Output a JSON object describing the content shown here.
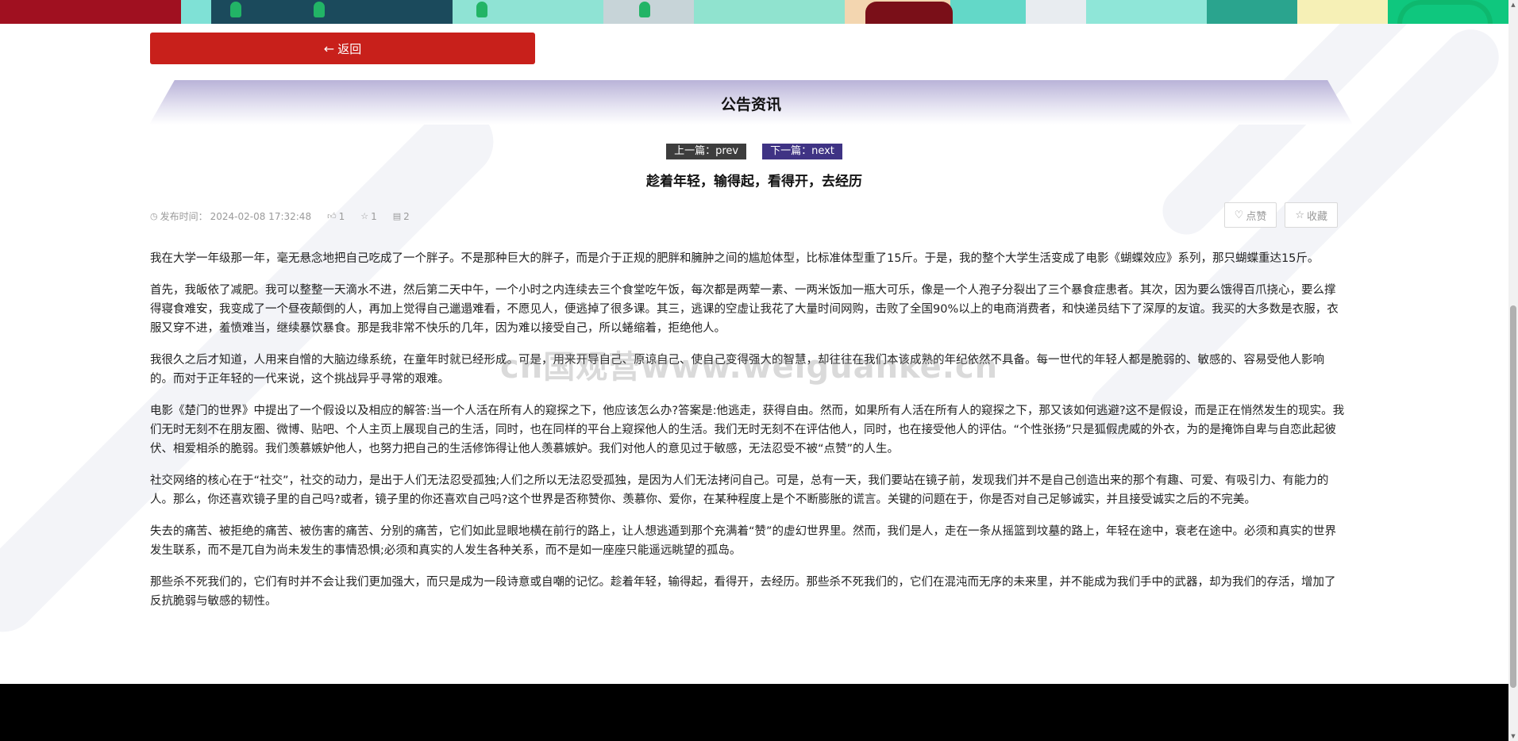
{
  "nav": {
    "back_label": "返回"
  },
  "section": {
    "title": "公告资讯"
  },
  "pager": {
    "prev_label": "上一篇：prev",
    "next_label": "下一篇：next"
  },
  "article": {
    "title": "趁着年轻，输得起，看得开，去经历",
    "meta": {
      "publish_label": "发布时间：",
      "publish_time": "2024-02-08 17:32:48",
      "likes": "1",
      "favorites": "1",
      "comments": "2"
    },
    "actions": {
      "like_label": "点赞",
      "favorite_label": "收藏"
    },
    "paragraphs": [
      "我在大学一年级那一年，毫无悬念地把自己吃成了一个胖子。不是那种巨大的胖子，而是介于正规的肥胖和臃肿之间的尴尬体型，比标准体型重了15斤。于是，我的整个大学生活变成了电影《蝴蝶效应》系列，那只蝴蝶重达15斤。",
      "首先，我皈依了减肥。我可以整整一天滴水不进，然后第二天中午，一个小时之内连续去三个食堂吃午饭，每次都是两荤一素、一两米饭加一瓶大可乐，像是一个人孢子分裂出了三个暴食症患者。其次，因为要么饿得百爪挠心，要么撑得寝食难安，我变成了一个昼夜颠倒的人，再加上觉得自己邋遢难看，不愿见人，便逃掉了很多课。其三，逃课的空虚让我花了大量时间网购，击败了全国90%以上的电商消费者，和快递员结下了深厚的友谊。我买的大多数是衣服，衣服又穿不进，羞愤难当，继续暴饮暴食。那是我非常不快乐的几年，因为难以接受自己，所以蜷缩着，拒绝他人。",
      "我很久之后才知道，人用来自憎的大脑边缘系统，在童年时就已经形成。可是，用来开导自己、原谅自己、使自己变得强大的智慧，却往往在我们本该成熟的年纪依然不具备。每一世代的年轻人都是脆弱的、敏感的、容易受他人影响的。而对于正年轻的一代来说，这个挑战异乎寻常的艰难。",
      "电影《楚门的世界》中提出了一个假设以及相应的解答:当一个人活在所有人的窥探之下，他应该怎么办?答案是:他逃走，获得自由。然而，如果所有人活在所有人的窥探之下，那又该如何逃避?这不是假设，而是正在悄然发生的现实。我们无时无刻不在朋友圈、微博、贴吧、个人主页上展现自己的生活，同时，也在同样的平台上窥探他人的生活。我们无时无刻不在评估他人，同时，也在接受他人的评估。“个性张扬”只是狐假虎威的外衣，为的是掩饰自卑与自恋此起彼伏、相爱相杀的脆弱。我们羡慕嫉妒他人，也努力把自己的生活修饰得让他人羡慕嫉妒。我们对他人的意见过于敏感，无法忍受不被“点赞”的人生。",
      "社交网络的核心在于“社交”，社交的动力，是出于人们无法忍受孤独;人们之所以无法忍受孤独，是因为人们无法拷问自己。可是，总有一天，我们要站在镜子前，发现我们并不是自己创造出来的那个有趣、可爱、有吸引力、有能力的人。那么，你还喜欢镜子里的自己吗?或者，镜子里的你还喜欢自己吗?这个世界是否称赞你、羡慕你、爱你，在某种程度上是个不断膨胀的谎言。关键的问题在于，你是否对自己足够诚实，并且接受诚实之后的不完美。",
      "失去的痛苦、被拒绝的痛苦、被伤害的痛苦、分别的痛苦，它们如此显眼地横在前行的路上，让人想逃遁到那个充满着“赞”的虚幻世界里。然而，我们是人，走在一条从摇篮到坟墓的路上，年轻在途中，衰老在途中。必须和真实的世界发生联系，而不是兀自为尚未发生的事情恐惧;必须和真实的人发生各种关系，而不是如一座座只能遥远眺望的孤岛。",
      "那些杀不死我们的，它们有时并不会让我们更加强大，而只是成为一段诗意或自嘲的记忆。趁着年轻，输得起，看得开，去经历。那些杀不死我们的，它们在混沌而无序的未来里，并不能成为我们手中的武器，却为我们的存活，增加了反抗脆弱与敏感的韧性。"
    ]
  },
  "watermark": "cn国观营www.weiguanke.cn",
  "icons": {
    "back": "arrow-left-icon",
    "clock": "clock-icon",
    "thumb": "thumb-up-icon",
    "star": "star-icon",
    "comment": "comment-icon",
    "heart": "heart-icon"
  },
  "colors": {
    "accent_red": "#c8201b",
    "next_purple": "#3f3384",
    "prev_dark": "#3d3d3d"
  }
}
